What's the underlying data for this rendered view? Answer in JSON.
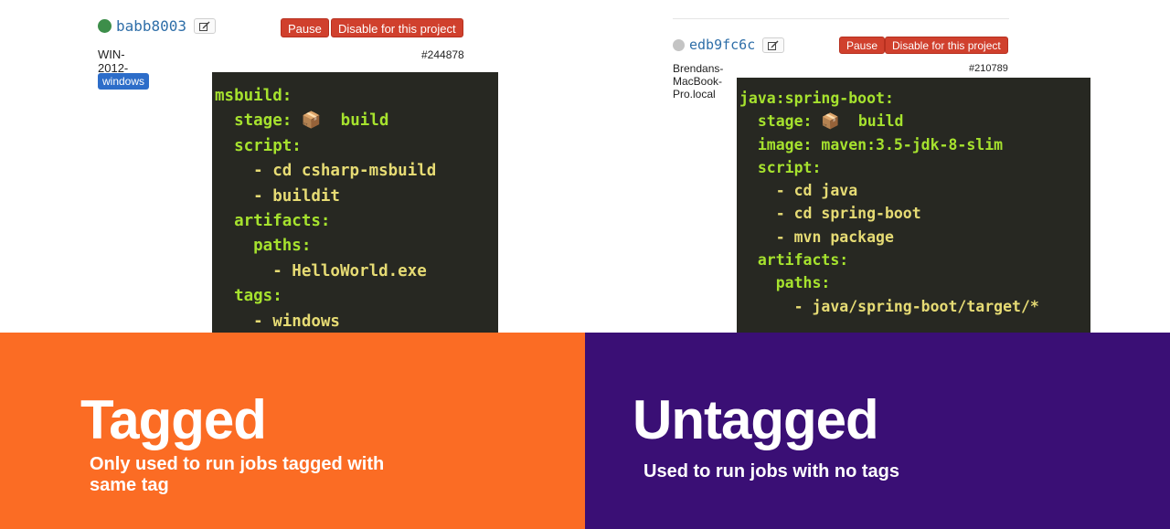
{
  "runner_left": {
    "status_color": "#3d8e4a",
    "token": "babb8003",
    "edit_icon": "edit-icon",
    "pause_label": "Pause",
    "disable_label": "Disable for this project",
    "description": "WIN-2012-EC2",
    "id": "#244878",
    "tag": "windows",
    "code_lines": [
      "msbuild:",
      "  stage: 📦  build",
      "  script:",
      "    - cd csharp-msbuild",
      "    - buildit",
      "  artifacts:",
      "    paths:",
      "      - HelloWorld.exe",
      "  tags:",
      "    - windows"
    ]
  },
  "runner_right": {
    "status_color": "#c4c4c4",
    "token": "edb9fc6c",
    "edit_icon": "edit-icon",
    "pause_label": "Pause",
    "disable_label": "Disable for this project",
    "description": "Brendans-MacBook-Pro.local",
    "id": "#210789",
    "code_lines": [
      "java:spring-boot:",
      "  stage: 📦  build",
      "  image: maven:3.5-jdk-8-slim",
      "  script:",
      "    - cd java",
      "    - cd spring-boot",
      "    - mvn package",
      "  artifacts:",
      "    paths:",
      "      - java/spring-boot/target/*"
    ]
  },
  "tagged_panel": {
    "color": "#fb6c24",
    "title": "Tagged",
    "subtitle_line1": "Only used to run jobs tagged with",
    "subtitle_line2": "same tag"
  },
  "untagged_panel": {
    "color": "#3a0f75",
    "title": "Untagged",
    "subtitle": "Used to run jobs with no tags"
  }
}
